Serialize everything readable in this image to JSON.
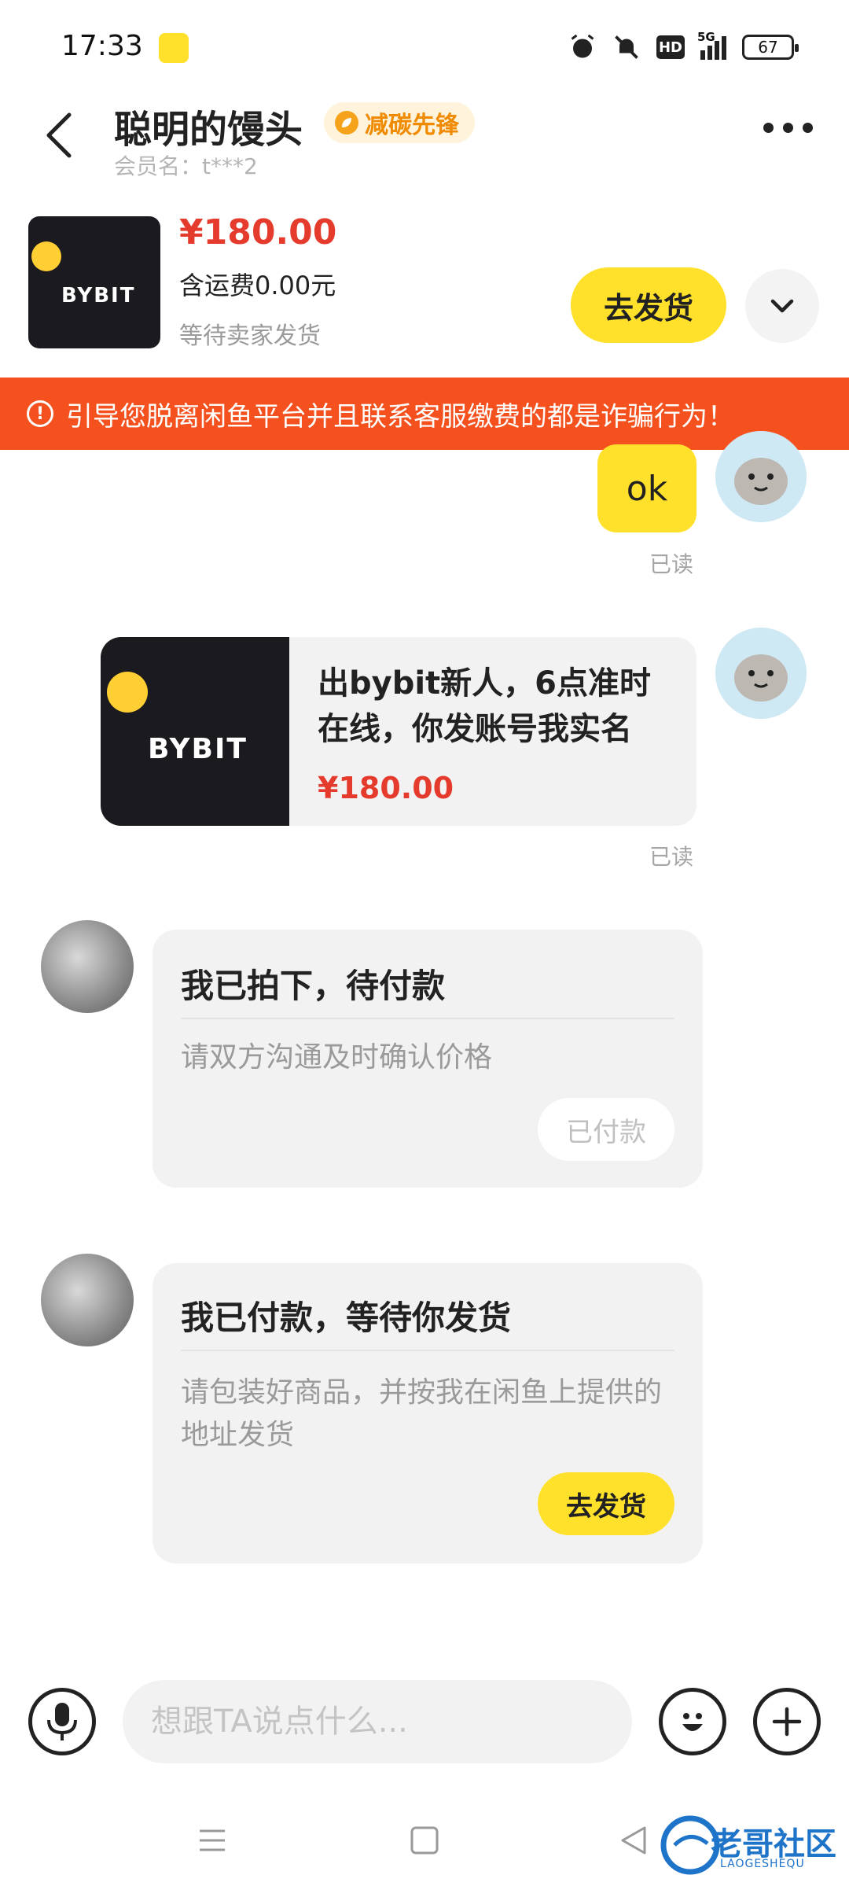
{
  "status_bar": {
    "time": "17:33",
    "network": "5G",
    "battery": "67"
  },
  "header": {
    "title": "聪明的馒头",
    "badge": "减碳先锋",
    "member": "会员名：t***2"
  },
  "product": {
    "price": "¥180.00",
    "shipping": "含运费0.00元",
    "status": "等待卖家发货",
    "ship_button": "去发货",
    "logo_text": "BYBIT"
  },
  "warning": {
    "text": "引导您脱离闲鱼平台并且联系客服缴费的都是诈骗行为！"
  },
  "messages": {
    "ok_text": "ok",
    "read_1": "已读",
    "item_title": "出bybit新人，6点准时在线，你发账号我实名",
    "item_price": "¥180.00",
    "item_logo": "BYBIT",
    "read_2": "已读",
    "card1": {
      "title": "我已拍下，待付款",
      "desc": "请双方沟通及时确认价格",
      "button": "已付款"
    },
    "card2": {
      "title": "我已付款，等待你发货",
      "desc": "请包装好商品，并按我在闲鱼上提供的地址发货",
      "button": "去发货"
    }
  },
  "input": {
    "placeholder": "想跟TA说点什么..."
  },
  "watermark": {
    "text": "老哥社区",
    "subtext": "LAOGESHEQU"
  },
  "colors": {
    "accent": "#ffe12b",
    "price": "#e53b2c",
    "warning": "#f4511e"
  }
}
